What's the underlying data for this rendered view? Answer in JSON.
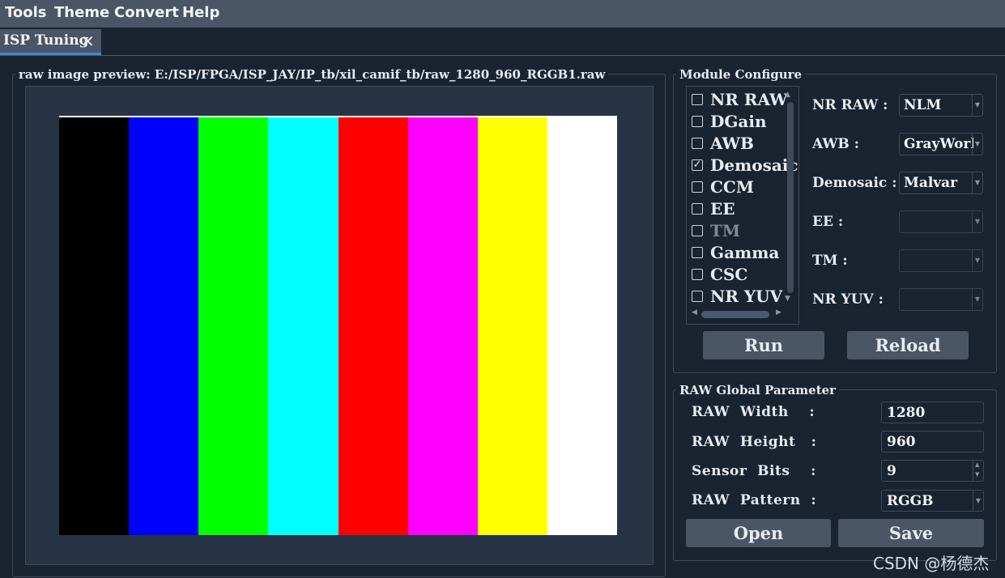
{
  "menubar": {
    "items": [
      "Tools",
      "Theme",
      "Convert",
      "Help"
    ]
  },
  "tab": {
    "label": "ISP Tuning",
    "close_icon": "close-icon"
  },
  "preview": {
    "title": "raw image preview: E:/ISP/FPGA/ISP_JAY/IP_tb/xil_camif_tb/raw_1280_960_RGGB1.raw",
    "bar_colors": [
      "#000000",
      "#0000ff",
      "#00ff00",
      "#00ffff",
      "#ff0000",
      "#ff00ff",
      "#ffff00",
      "#ffffff"
    ]
  },
  "module_configure": {
    "title": "Module Configure",
    "modules": [
      {
        "label": "NR RAW",
        "checked": false,
        "enabled": true
      },
      {
        "label": "DGain",
        "checked": false,
        "enabled": true
      },
      {
        "label": "AWB",
        "checked": false,
        "enabled": true
      },
      {
        "label": "Demosaic",
        "checked": true,
        "enabled": true
      },
      {
        "label": "CCM",
        "checked": false,
        "enabled": true
      },
      {
        "label": "EE",
        "checked": false,
        "enabled": true
      },
      {
        "label": "TM",
        "checked": false,
        "enabled": false
      },
      {
        "label": "Gamma",
        "checked": false,
        "enabled": true
      },
      {
        "label": "CSC",
        "checked": false,
        "enabled": true
      },
      {
        "label": "NR YUV",
        "checked": false,
        "enabled": true
      }
    ],
    "configs": [
      {
        "label": "NR RAW :",
        "value": "NLM"
      },
      {
        "label": "AWB :",
        "value": "GrayWorld"
      },
      {
        "label": "Demosaic :",
        "value": "Malvar"
      },
      {
        "label": "EE :",
        "value": ""
      },
      {
        "label": "TM :",
        "value": ""
      },
      {
        "label": "NR YUV :",
        "value": ""
      }
    ],
    "run_label": "Run",
    "reload_label": "Reload"
  },
  "raw_params": {
    "title": "RAW  Global  Parameter",
    "width_label": "RAW  Width    :",
    "width_value": "1280",
    "height_label": "RAW  Height   :",
    "height_value": "960",
    "bits_label": "Sensor  Bits    :",
    "bits_value": "9",
    "pattern_label": "RAW  Pattern  :",
    "pattern_value": "RGGB",
    "open_label": "Open",
    "save_label": "Save"
  },
  "watermark": "CSDN @杨德杰",
  "colors": {
    "background": "#1a2330",
    "panel": "#273446",
    "button": "#4a5566",
    "accent": "#3a8ad6"
  }
}
